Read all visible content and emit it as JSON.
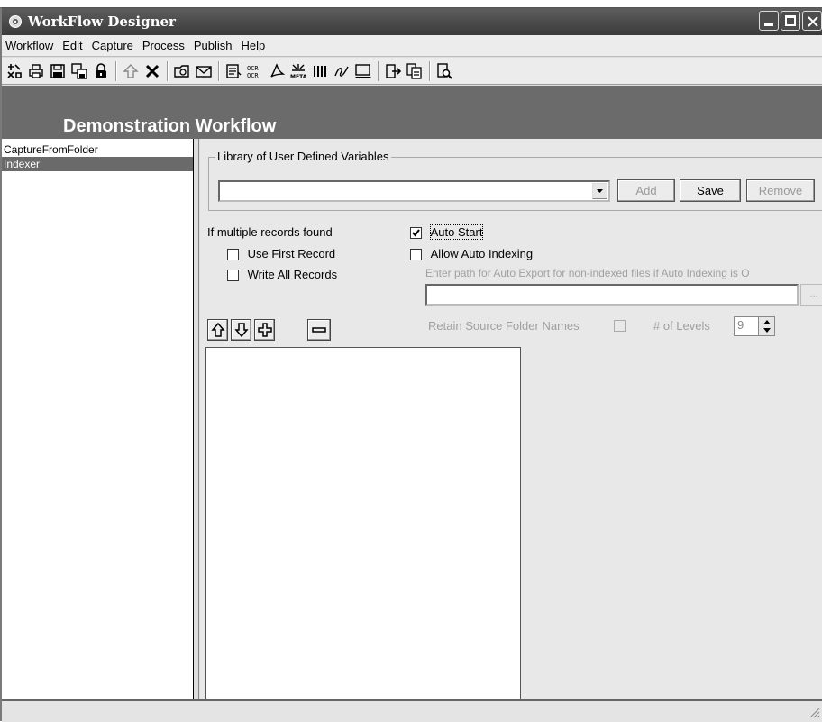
{
  "window": {
    "title": "WorkFlow Designer"
  },
  "menu": [
    "Workflow",
    "Edit",
    "Capture",
    "Process",
    "Publish",
    "Help"
  ],
  "toolbar": {
    "icons": [
      "new-workflow-icon",
      "print-icon",
      "save-icon",
      "save-as-icon",
      "lock-icon",
      "up-arrow-icon",
      "delete-icon",
      "folder-capture-icon",
      "email-capture-icon",
      "scanner-icon",
      "ocr-icon",
      "pdf-icon",
      "meta-icon",
      "barcode-icon",
      "signature-icon",
      "image-icon",
      "export-icon",
      "export-copy-icon",
      "preview-icon"
    ]
  },
  "banner": {
    "title": "Demonstration Workflow"
  },
  "steps": [
    {
      "label": "CaptureFromFolder",
      "selected": false
    },
    {
      "label": "Indexer",
      "selected": true
    }
  ],
  "library": {
    "group_label": "Library of User Defined Variables",
    "combo_value": "",
    "add_label": "Add",
    "save_label": "Save",
    "remove_label": "Remove"
  },
  "records": {
    "heading": "If multiple records found",
    "use_first_label": "Use First Record",
    "use_first_checked": false,
    "write_all_label": "Write All Records",
    "write_all_checked": false
  },
  "auto": {
    "auto_start_label": "Auto Start",
    "auto_start_checked": true,
    "allow_auto_index_label": "Allow Auto Indexing",
    "allow_auto_index_checked": false,
    "export_path_hint": "Enter path for Auto Export for non-indexed files if Auto Indexing is O",
    "export_path_value": "",
    "browse_label": "...",
    "retain_label": "Retain Source Folder Names",
    "levels_label": "# of Levels",
    "levels_value": "9"
  },
  "list_controls": [
    "move-up-icon",
    "move-down-icon",
    "add-icon",
    "remove-icon"
  ]
}
